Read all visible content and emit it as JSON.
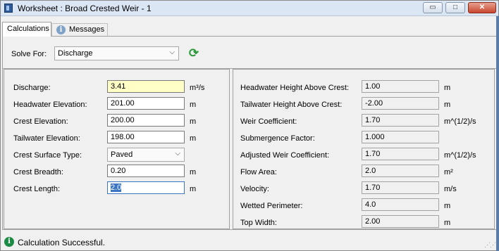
{
  "window": {
    "title": "Worksheet : Broad Crested Weir - 1",
    "min": "▭",
    "max": "□",
    "close": "✕"
  },
  "tabs": [
    {
      "label": "Calculations"
    },
    {
      "label": "Messages"
    }
  ],
  "solve": {
    "label": "Solve For:",
    "value": "Discharge"
  },
  "left": [
    {
      "label": "Discharge:",
      "value": "3.41",
      "unit": "m³/s"
    },
    {
      "label": "Headwater Elevation:",
      "value": "201.00",
      "unit": "m"
    },
    {
      "label": "Crest Elevation:",
      "value": "200.00",
      "unit": "m"
    },
    {
      "label": "Tailwater Elevation:",
      "value": "198.00",
      "unit": "m"
    },
    {
      "label": "Crest Surface Type:",
      "value": "Paved",
      "unit": ""
    },
    {
      "label": "Crest Breadth:",
      "value": "0.20",
      "unit": "m"
    },
    {
      "label": "Crest Length:",
      "value": "2.0",
      "unit": "m"
    }
  ],
  "right": [
    {
      "label": "Headwater Height Above Crest:",
      "value": "1.00",
      "unit": "m"
    },
    {
      "label": "Tailwater Height Above Crest:",
      "value": "-2.00",
      "unit": "m"
    },
    {
      "label": "Weir Coefficient:",
      "value": "1.70",
      "unit": "m^(1/2)/s"
    },
    {
      "label": "Submergence Factor:",
      "value": "1.000",
      "unit": ""
    },
    {
      "label": "Adjusted Weir Coefficient:",
      "value": "1.70",
      "unit": "m^(1/2)/s"
    },
    {
      "label": "Flow Area:",
      "value": "2.0",
      "unit": "m²"
    },
    {
      "label": "Velocity:",
      "value": "1.70",
      "unit": "m/s"
    },
    {
      "label": "Wetted Perimeter:",
      "value": "4.0",
      "unit": "m"
    },
    {
      "label": "Top Width:",
      "value": "2.00",
      "unit": "m"
    }
  ],
  "status": {
    "text": "Calculation Successful."
  },
  "icons": {
    "app": "worksheet-app-icon",
    "info": "info-icon",
    "refresh": "refresh-icon",
    "status": "info-icon",
    "chevron": "chevron-down-icon"
  }
}
